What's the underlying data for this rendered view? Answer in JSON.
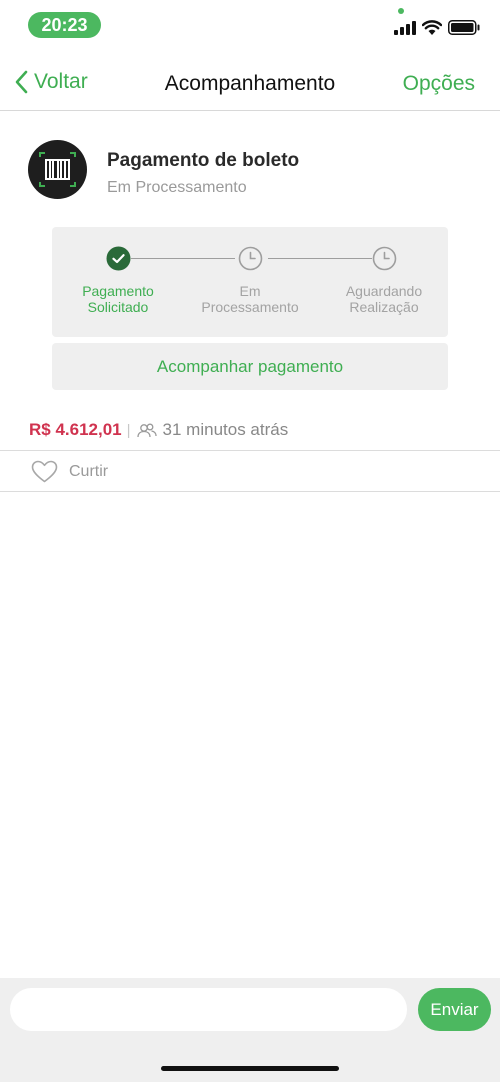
{
  "status_bar": {
    "time": "20:23",
    "icons": [
      "signal-icon",
      "wifi-icon",
      "battery-icon"
    ],
    "accent_color": "#4cb860"
  },
  "nav": {
    "back_label": "Voltar",
    "title": "Acompanhamento",
    "options_label": "Opções",
    "accent_color": "#3fae52"
  },
  "payment": {
    "icon": "barcode-icon",
    "title": "Pagamento de boleto",
    "status": "Em Processamento",
    "steps": [
      {
        "label_line1": "Pagamento",
        "label_line2": "Solicitado",
        "state": "done",
        "icon": "check-icon"
      },
      {
        "label_line1": "Em",
        "label_line2": "Processamento",
        "state": "pending",
        "icon": "clock-icon"
      },
      {
        "label_line1": "Aguardando",
        "label_line2": "Realização",
        "state": "pending",
        "icon": "clock-icon"
      }
    ],
    "track_button_label": "Acompanhar pagamento"
  },
  "meta": {
    "amount": "R$ 4.612,01",
    "separator": "|",
    "audience_icon": "people-icon",
    "elapsed": "31 minutos atrás",
    "amount_color": "#d0334f"
  },
  "actions": {
    "like_icon": "heart-icon",
    "like_label": "Curtir"
  },
  "composer": {
    "input_placeholder": "",
    "send_label": "Enviar"
  }
}
